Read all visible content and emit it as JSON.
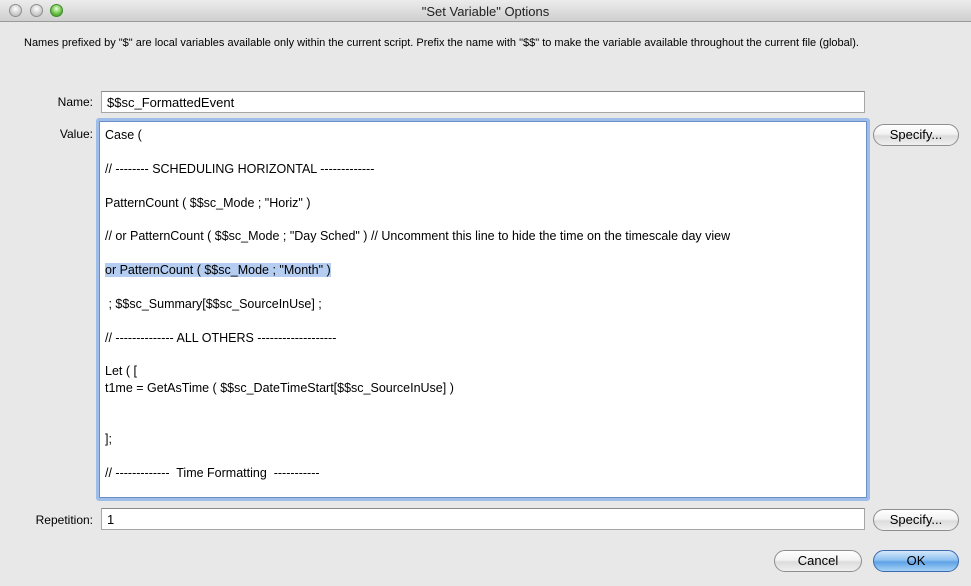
{
  "window": {
    "title": "\"Set Variable\" Options"
  },
  "description": "Names prefixed by \"$\" are local variables available only within the current script. Prefix the name with \"$$\" to make the variable available throughout the current file (global).",
  "form": {
    "name_label": "Name:",
    "name_value": "$$sc_FormattedEvent",
    "value_label": "Value:",
    "value_lines": [
      "Case (",
      "",
      "// -------- SCHEDULING HORIZONTAL -------------",
      "",
      "PatternCount ( $$sc_Mode ; \"Horiz\" )",
      "",
      "// or PatternCount ( $$sc_Mode ; \"Day Sched\" ) // Uncomment this line to hide the time on the timescale day view",
      "",
      "or PatternCount ( $$sc_Mode ; \"Month\" )",
      "",
      " ; $$sc_Summary[$$sc_SourceInUse] ;",
      "",
      "// -------------- ALL OTHERS -------------------",
      "",
      "Let ( [",
      "t1me = GetAsTime ( $$sc_DateTimeStart[$$sc_SourceInUse] )",
      "",
      "",
      "];",
      "",
      "// -------------  Time Formatting  -----------"
    ],
    "selected_line": 8,
    "repetition_label": "Repetition:",
    "repetition_value": "1"
  },
  "buttons": {
    "specify_value": "Specify...",
    "specify_repetition": "Specify...",
    "cancel": "Cancel",
    "ok": "OK"
  },
  "colors": {
    "selection": "#b4cdf0",
    "focus_ring": "#9ebde8",
    "default_button": "#5fa2e6"
  }
}
